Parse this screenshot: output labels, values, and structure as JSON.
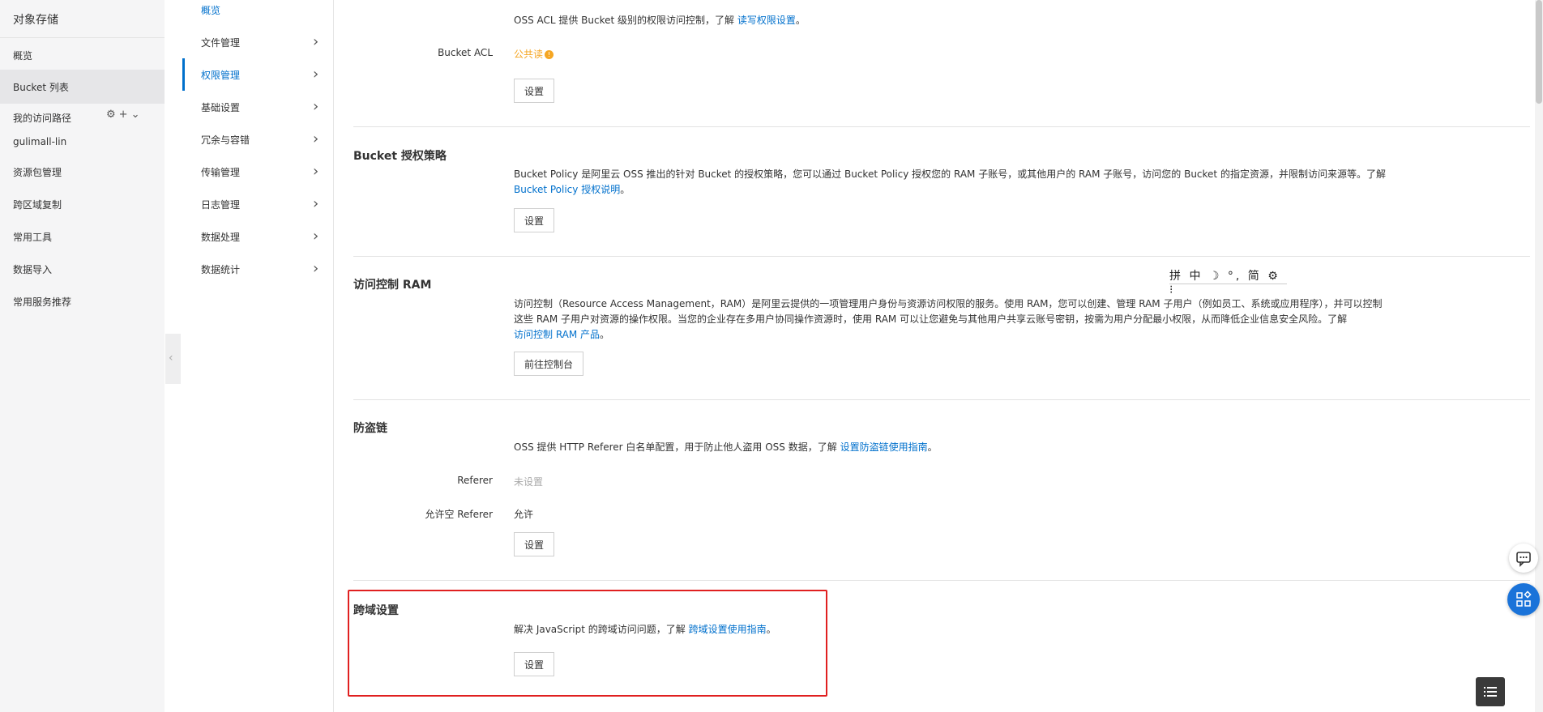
{
  "sidebar": {
    "title": "对象存储",
    "items": [
      {
        "label": "概览"
      },
      {
        "label": "Bucket 列表"
      },
      {
        "label": "我的访问路径"
      },
      {
        "label": "gulimall-lin"
      },
      {
        "label": "资源包管理"
      },
      {
        "label": "跨区域复制"
      },
      {
        "label": "常用工具"
      },
      {
        "label": "数据导入"
      },
      {
        "label": "常用服务推荐"
      }
    ],
    "tool_icons": [
      "gear-icon",
      "plus-icon",
      "chevron-down-icon"
    ]
  },
  "subnav": {
    "items": [
      {
        "label": "概览"
      },
      {
        "label": "文件管理"
      },
      {
        "label": "权限管理"
      },
      {
        "label": "基础设置"
      },
      {
        "label": "冗余与容错"
      },
      {
        "label": "传输管理"
      },
      {
        "label": "日志管理"
      },
      {
        "label": "数据处理"
      },
      {
        "label": "数据统计"
      }
    ],
    "active": "权限管理"
  },
  "acl": {
    "desc": "OSS ACL 提供 Bucket 级别的权限访问控制，了解",
    "link": "读写权限设置",
    "tail": "。",
    "field_label": "Bucket ACL",
    "field_value": "公共读",
    "button": "设置"
  },
  "policy": {
    "title": "Bucket 授权策略",
    "desc": "Bucket Policy 是阿里云 OSS 推出的针对 Bucket 的授权策略，您可以通过 Bucket Policy 授权您的 RAM 子账号，或其他用户的 RAM 子账号，访问您的 Bucket 的指定资源，并限制访问来源等。了解",
    "link": "Bucket Policy 授权说明",
    "tail": "。",
    "button": "设置"
  },
  "ram": {
    "title": "访问控制 RAM",
    "desc": "访问控制（Resource Access Management，RAM）是阿里云提供的一项管理用户身份与资源访问权限的服务。使用 RAM，您可以创建、管理 RAM 子用户（例如员工、系统或应用程序），并可以控制这些 RAM 子用户对资源的操作权限。当您的企业存在多用户协同操作资源时，使用 RAM 可以让您避免与其他用户共享云账号密钥，按需为用户分配最小权限，从而降低企业信息安全风险。了解",
    "link": "访问控制 RAM 产品",
    "tail": "。",
    "button": "前往控制台"
  },
  "ime": {
    "text": "拼 中 ☽ °, 简 ⚙ ⁝"
  },
  "referer": {
    "title": "防盗链",
    "desc": "OSS 提供 HTTP Referer 白名单配置，用于防止他人盗用 OSS 数据，了解",
    "link": "设置防盗链使用指南",
    "tail": "。",
    "label1": "Referer",
    "value1": "未设置",
    "label2": "允许空 Referer",
    "value2": "允许",
    "button": "设置"
  },
  "cors": {
    "title": "跨域设置",
    "desc": "解决 JavaScript 的跨域访问问题，了解",
    "link": "跨域设置使用指南",
    "tail": "。",
    "button": "设置"
  },
  "colors": {
    "accent": "#0070cc",
    "highlight": "#e02020",
    "warning": "#f5a623"
  }
}
